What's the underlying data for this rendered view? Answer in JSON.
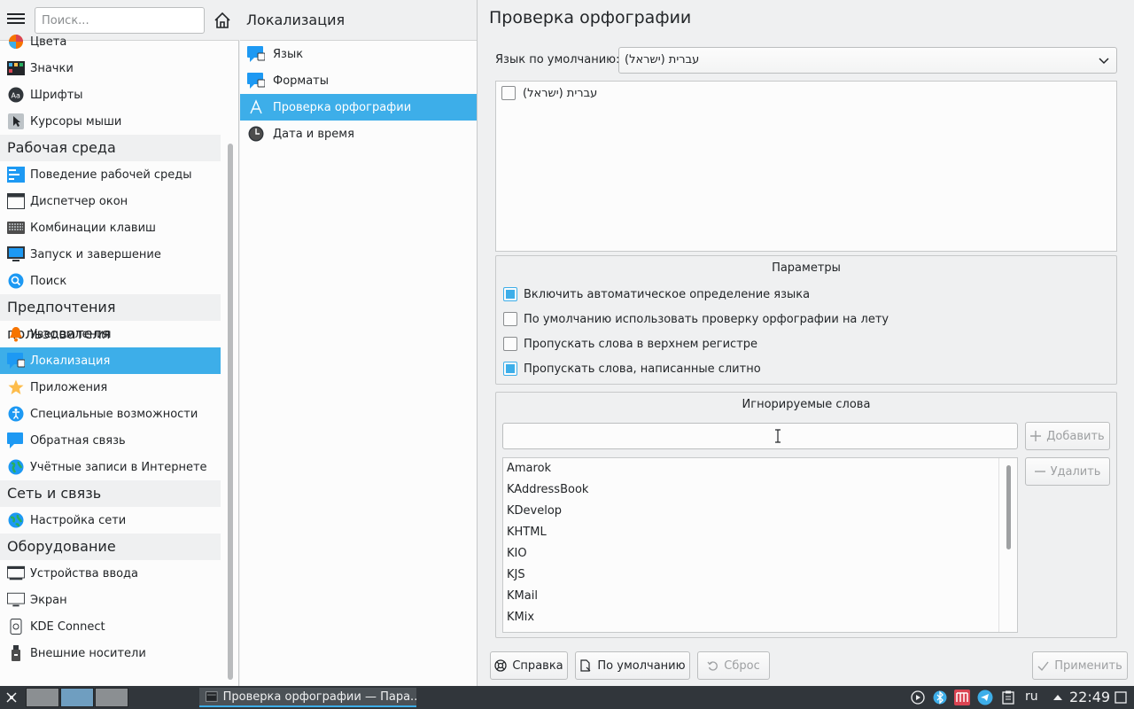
{
  "sidebar": {
    "search_placeholder": "Поиск...",
    "items": [
      {
        "type": "item",
        "label": "Цвета",
        "icon": "colors-icon"
      },
      {
        "type": "item",
        "label": "Значки",
        "icon": "icons-icon"
      },
      {
        "type": "item",
        "label": "Шрифты",
        "icon": "fonts-icon"
      },
      {
        "type": "item",
        "label": "Курсоры мыши",
        "icon": "cursor-icon"
      },
      {
        "type": "cat",
        "label": "Рабочая среда"
      },
      {
        "type": "item",
        "label": "Поведение рабочей среды",
        "icon": "desktop-behavior-icon"
      },
      {
        "type": "item",
        "label": "Диспетчер окон",
        "icon": "window-manager-icon"
      },
      {
        "type": "item",
        "label": "Комбинации клавиш",
        "icon": "keyboard-icon"
      },
      {
        "type": "item",
        "label": "Запуск и завершение",
        "icon": "startup-icon"
      },
      {
        "type": "item",
        "label": "Поиск",
        "icon": "search-icon"
      },
      {
        "type": "cat",
        "label": "Предпочтения пользователя"
      },
      {
        "type": "item",
        "label": "Уведомления",
        "icon": "bell-icon"
      },
      {
        "type": "item",
        "label": "Локализация",
        "icon": "localization-icon",
        "selected": true
      },
      {
        "type": "item",
        "label": "Приложения",
        "icon": "star-icon"
      },
      {
        "type": "item",
        "label": "Специальные возможности",
        "icon": "accessibility-icon"
      },
      {
        "type": "item",
        "label": "Обратная связь",
        "icon": "feedback-icon"
      },
      {
        "type": "item",
        "label": "Учётные записи в Интернете",
        "icon": "globe-icon"
      },
      {
        "type": "cat",
        "label": "Сеть и связь"
      },
      {
        "type": "item",
        "label": "Настройка сети",
        "icon": "network-icon"
      },
      {
        "type": "cat",
        "label": "Оборудование"
      },
      {
        "type": "item",
        "label": "Устройства ввода",
        "icon": "input-devices-icon"
      },
      {
        "type": "item",
        "label": "Экран",
        "icon": "monitor-icon"
      },
      {
        "type": "item",
        "label": "KDE Connect",
        "icon": "phone-icon"
      },
      {
        "type": "item",
        "label": "Внешние носители",
        "icon": "usb-icon"
      }
    ]
  },
  "middle": {
    "title": "Локализация",
    "items": [
      {
        "label": "Язык",
        "icon": "language-icon"
      },
      {
        "label": "Форматы",
        "icon": "formats-icon"
      },
      {
        "label": "Проверка орфографии",
        "icon": "spellcheck-icon",
        "selected": true
      },
      {
        "label": "Дата и время",
        "icon": "clock-icon"
      }
    ]
  },
  "main": {
    "title": "Проверка орфографии",
    "default_language_label": "Язык по умолчанию:",
    "default_language_value": "עברית (ישראל)",
    "languages": [
      {
        "label": "עברית (ישראל)",
        "checked": false
      }
    ],
    "params": {
      "title": "Параметры",
      "options": [
        {
          "label": "Включить автоматическое определение языка",
          "checked": true
        },
        {
          "label": "По умолчанию использовать проверку орфографии на лету",
          "checked": false
        },
        {
          "label": "Пропускать слова в верхнем регистре",
          "checked": false
        },
        {
          "label": "Пропускать слова, написанные слитно",
          "checked": true
        }
      ]
    },
    "ignored": {
      "title": "Игнорируемые слова",
      "input_value": "",
      "add_label": "Добавить",
      "remove_label": "Удалить",
      "words": [
        "Amarok",
        "KAddressBook",
        "KDevelop",
        "KHTML",
        "KIO",
        "KJS",
        "KMail",
        "KMix"
      ]
    },
    "buttons": {
      "help": "Справка",
      "defaults": "По умолчанию",
      "reset": "Сброс",
      "apply": "Применить"
    }
  },
  "taskbar": {
    "task_title": "Проверка орфографии — Пара...",
    "keyboard_layout": "ru",
    "clock": "22:49"
  },
  "colors": {
    "accent": "#3daee9",
    "window_bg": "#eff0f1",
    "view_bg": "#fcfcfc",
    "taskbar_bg": "#31363b"
  }
}
